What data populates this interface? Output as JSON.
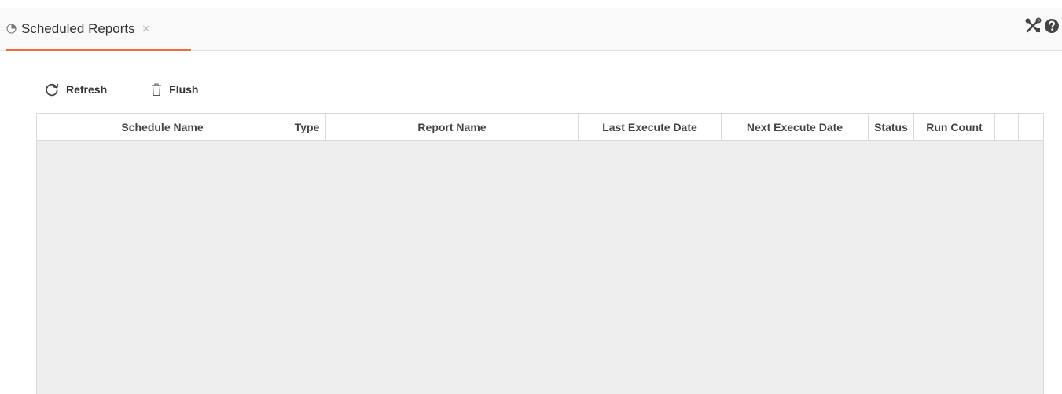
{
  "tabs": [
    {
      "label": "Scheduled Reports",
      "icon": "report-tab-icon",
      "closable": true
    }
  ],
  "tab_close_glyph": "×",
  "header_tools": [
    {
      "icon": "tools-icon"
    },
    {
      "icon": "help-icon"
    }
  ],
  "toolbar": {
    "refresh_label": "Refresh",
    "flush_label": "Flush"
  },
  "grid": {
    "columns": [
      "Schedule Name",
      "Type",
      "Report Name",
      "Last Execute Date",
      "Next Execute Date",
      "Status",
      "Run Count",
      "",
      ""
    ],
    "rows": []
  },
  "colors": {
    "accent": "#f26b3a",
    "tab_bar_bg": "#f9f9f9",
    "grid_body_bg": "#eeeeee",
    "border": "#d9d9d9"
  }
}
